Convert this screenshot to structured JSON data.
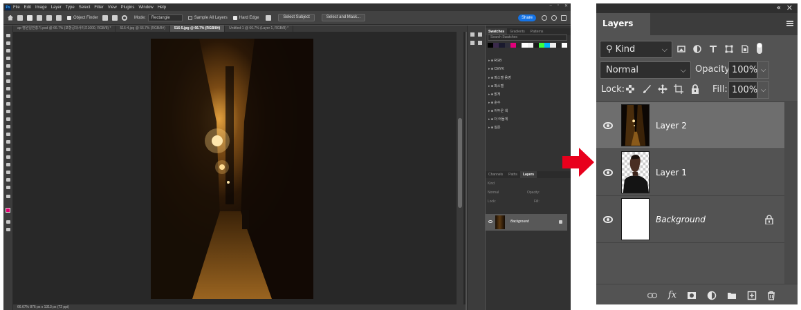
{
  "photoshop": {
    "app_logo": "Ps",
    "menu": [
      "File",
      "Edit",
      "Image",
      "Layer",
      "Type",
      "Select",
      "Filter",
      "View",
      "Plugins",
      "Window",
      "Help"
    ],
    "window_controls": [
      "–",
      "▫",
      "✕"
    ],
    "options_bar": {
      "object_finder": "Object Finder",
      "mode_label": "Mode:",
      "mode_value": "Rectangle",
      "sample_all_layers": "Sample All Layers",
      "hard_edge": "Hard Edge",
      "select_subject": "Select Subject",
      "select_and_mask": "Select and Mask...",
      "share": "Share"
    },
    "doc_tabs": [
      {
        "label": "ap-병원일반홍기.psd @ 66.7% (포항공대사이즈1000, RGB/8) *",
        "active": false
      },
      {
        "label": "516-4.jpg @ 66.7% (RGB/8#)",
        "active": false
      },
      {
        "label": "516-5.jpg @ 66.7% (RGB/8#)",
        "active": true
      },
      {
        "label": "Untitled-1 @ 66.7% (Layer 1, RGB/8) *",
        "active": false
      }
    ],
    "status_bar": "66.67%     876 px x 1313 px (72 ppi)",
    "right_panel": {
      "swatch_tabs": [
        "Swatches",
        "Gradients",
        "Patterns"
      ],
      "swatch_search": "Search Swatches",
      "swatch_colors": [
        "#000000",
        "#3a2a4a",
        "#1a1a2e",
        "#2e2e3a",
        "#e2007a",
        "#2b2b2b",
        "#ffffff",
        "#f2f2f2",
        "#1a1a1a",
        "#3cff3c",
        "#00b4ff",
        "#f0f0f0",
        "#2a2a2a",
        "#ffffff"
      ],
      "swatch_groups": [
        "RGB",
        "CMYK",
        "파스텔 음영",
        "파스텔",
        "밝게",
        "순수",
        "어두운 색",
        "더 어둡게",
        "짙은"
      ],
      "layers_tabs": [
        "Channels",
        "Paths",
        "Layers"
      ],
      "mini_kind": "Kind",
      "mini_normal": "Normal",
      "mini_opacity": "Opacity:",
      "mini_lock": "Lock:",
      "mini_fill": "Fill:",
      "mini_layer": "Background"
    }
  },
  "layers_panel": {
    "collapse": "«",
    "close": "✕",
    "tab_title": "Layers",
    "filter_kind": "Kind",
    "blend_mode": "Normal",
    "opacity_label": "Opacity:",
    "opacity_value": "100%",
    "lock_label": "Lock:",
    "fill_label": "Fill:",
    "fill_value": "100%",
    "layers": [
      {
        "name": "Layer 2",
        "visible": true,
        "selected": true,
        "thumbnail": "night-alley-photo"
      },
      {
        "name": "Layer 1",
        "visible": true,
        "selected": false,
        "thumbnail": "man-portrait-cutout"
      },
      {
        "name": "Background",
        "visible": true,
        "selected": false,
        "thumbnail": "white-fill",
        "locked": true
      }
    ],
    "footer_icons": [
      "link-icon",
      "fx-icon",
      "mask-icon",
      "adjustment-icon",
      "folder-icon",
      "new-layer-icon",
      "trash-icon"
    ],
    "footer_fx": "fx"
  },
  "colors": {
    "arrow": "#e8001c",
    "panel_bg": "#535353",
    "selected_row": "#6e6e6e",
    "share_blue": "#1473e6"
  }
}
